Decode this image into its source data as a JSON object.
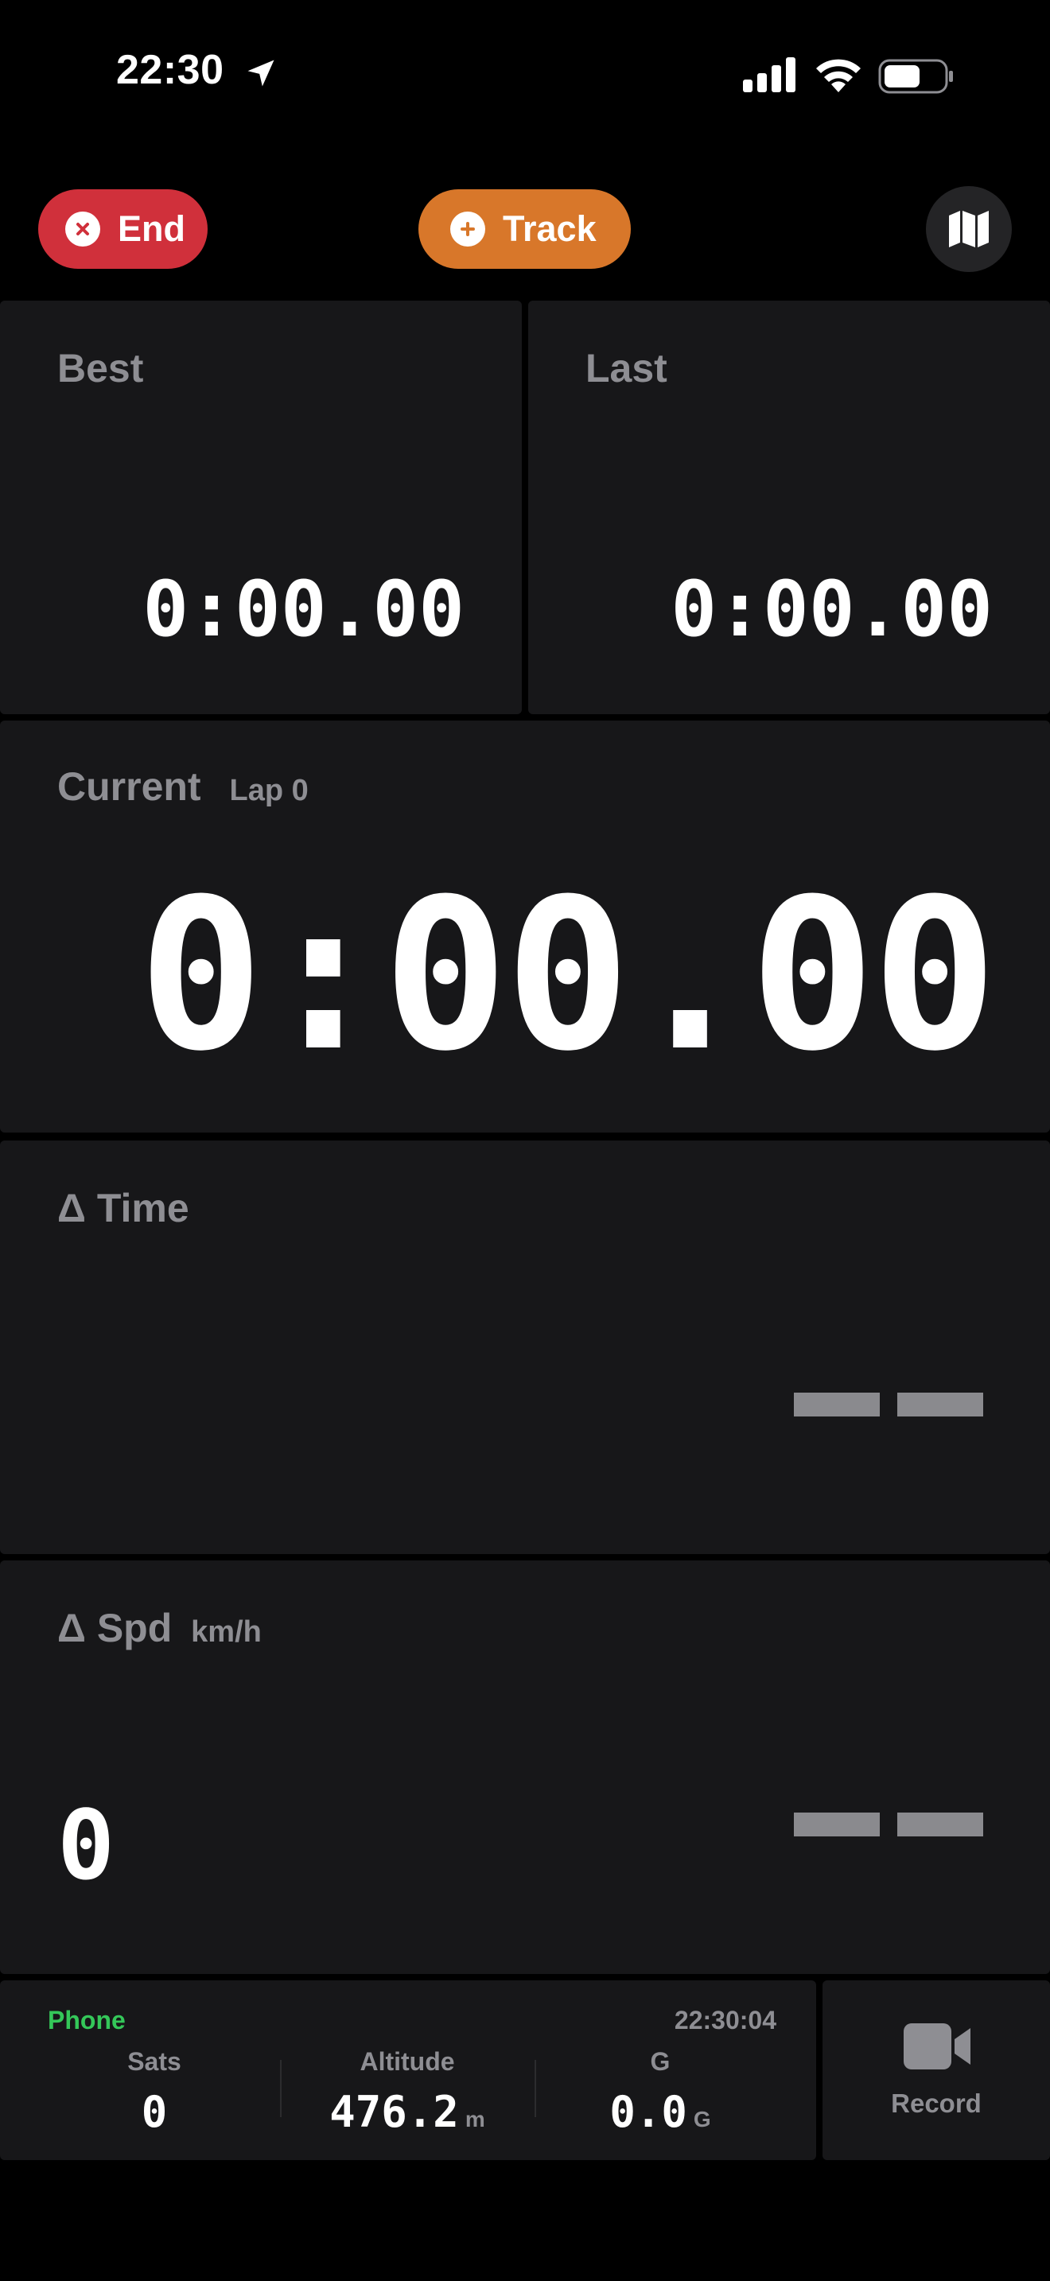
{
  "status_bar": {
    "time": "22:30",
    "icons": [
      "location-arrow-icon",
      "cellular-signal-icon",
      "wifi-icon",
      "battery-icon"
    ]
  },
  "toolbar": {
    "end_label": "End",
    "track_label": "Track",
    "map_icon": "map-icon"
  },
  "best": {
    "label": "Best",
    "value": "0:00.00"
  },
  "last": {
    "label": "Last",
    "value": "0:00.00"
  },
  "current": {
    "label": "Current",
    "lap": "Lap 0",
    "value": "0:00.00"
  },
  "delta_time": {
    "label": "Δ Time"
  },
  "delta_speed": {
    "label": "Δ Spd",
    "unit": "km/h",
    "value": "0"
  },
  "info": {
    "source": "Phone",
    "clock": "22:30:04",
    "sats_label": "Sats",
    "sats_value": "0",
    "altitude_label": "Altitude",
    "altitude_value": "476.2",
    "altitude_unit": "m",
    "g_label": "G",
    "g_value": "0.0",
    "g_unit": "G"
  },
  "record": {
    "label": "Record",
    "icon": "video-camera-icon"
  },
  "colors": {
    "end": "#d0303b",
    "track": "#d8772a",
    "panel": "#171719",
    "source_green": "#34c759",
    "label_gray": "#8e8e93"
  }
}
